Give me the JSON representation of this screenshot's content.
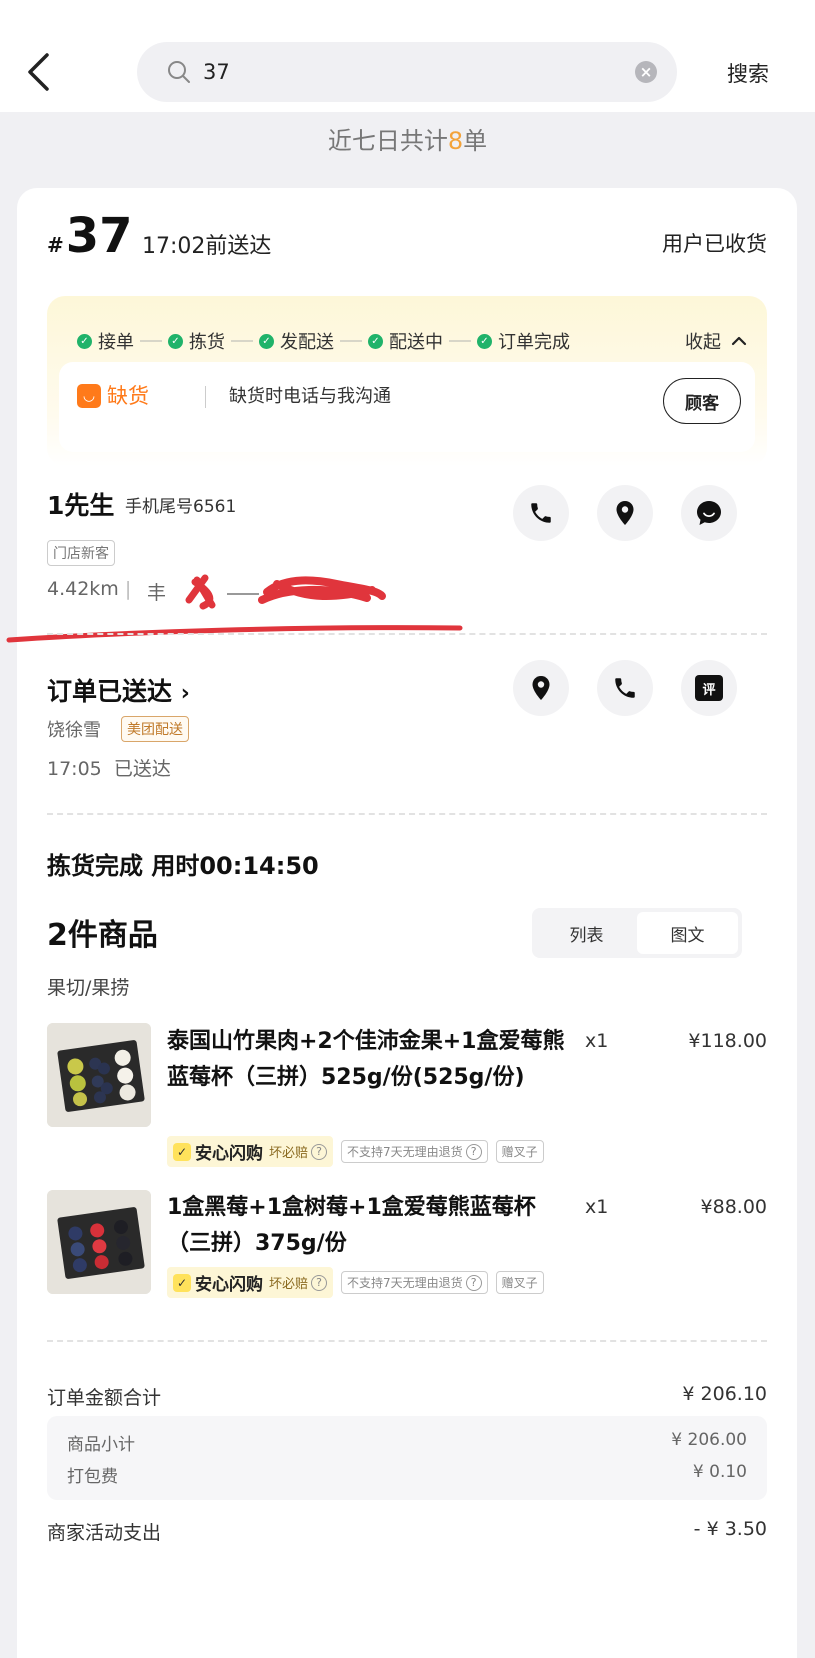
{
  "search": {
    "query": "37",
    "action_label": "搜索"
  },
  "summary": {
    "prefix": "近七日共计",
    "count": "8",
    "suffix": "单"
  },
  "order": {
    "hash": "#",
    "number": "37",
    "deliver_time": "17:02前送达",
    "status": "用户已收货",
    "steps": [
      "接单",
      "拣货",
      "发配送",
      "配送中",
      "订单完成"
    ],
    "collapse_label": "收起",
    "shortage": {
      "label": "缺货",
      "note": "缺货时电话与我沟通",
      "customer_button": "顾客"
    }
  },
  "customer": {
    "name": "1先生",
    "phone": "手机尾号6561",
    "tag": "门店新客",
    "distance": "4.42km",
    "address": "丰"
  },
  "delivery": {
    "title": "订单已送达",
    "rider": "饶徐雪",
    "tag": "美团配送",
    "time": "17:05",
    "status": "已送达",
    "review_icon_text": "评"
  },
  "picking": {
    "title": "拣货完成 用时00:14:50"
  },
  "goods": {
    "count_label": "2件商品",
    "view_list": "列表",
    "view_grid": "图文",
    "category": "果切/果捞",
    "items": [
      {
        "name": "泰国山竹果肉+2个佳沛金果+1盒爱莓熊蓝莓杯（三拼）525g/份(525g/份)",
        "qty": "x1",
        "price": "¥118.00",
        "badge_main": "安心闪购",
        "badge_sub": "坏必赔",
        "badge_return": "不支持7天无理由退货",
        "badge_gift": "赠叉子"
      },
      {
        "name": "1盒黑莓+1盒树莓+1盒爱莓熊蓝莓杯（三拼）375g/份",
        "qty": "x1",
        "price": "¥88.00",
        "badge_main": "安心闪购",
        "badge_sub": "坏必赔",
        "badge_return": "不支持7天无理由退货",
        "badge_gift": "赠叉子"
      }
    ]
  },
  "amounts": {
    "total_label": "订单金额合计",
    "total": "¥ 206.10",
    "subtotal_label": "商品小计",
    "subtotal": "¥ 206.00",
    "packing_label": "打包费",
    "packing": "¥ 0.10",
    "activity_label": "商家活动支出",
    "activity": "- ¥ 3.50"
  },
  "colors": {
    "accent": "#f3a33a",
    "success": "#20b36a",
    "shortage": "#ff7a1a"
  }
}
